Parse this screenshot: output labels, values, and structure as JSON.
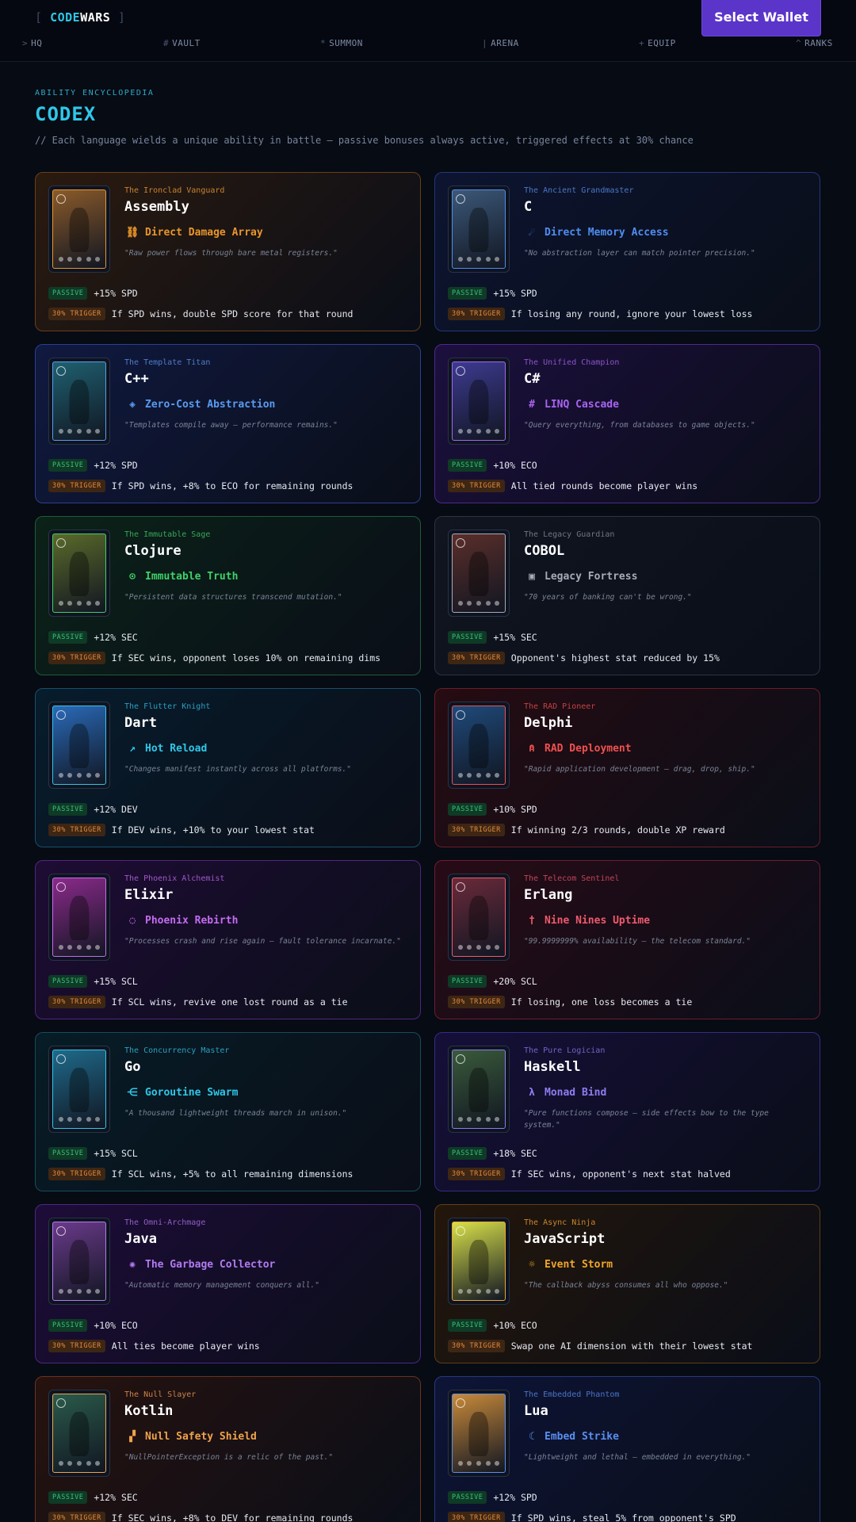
{
  "header": {
    "logo_bracket_left": "[",
    "logo_code": "CODE",
    "logo_wars": "WARS",
    "logo_bracket_right": "]",
    "wallet_button": "Select Wallet"
  },
  "nav": [
    {
      "icon": ">",
      "label": "HQ"
    },
    {
      "icon": "#",
      "label": "VAULT"
    },
    {
      "icon": "*",
      "label": "SUMMON"
    },
    {
      "icon": "|",
      "label": "ARENA"
    },
    {
      "icon": "+",
      "label": "EQUIP"
    },
    {
      "icon": "^",
      "label": "RANKS"
    }
  ],
  "intro": {
    "eyebrow": "ABILITY ENCYCLOPEDIA",
    "title": "CODEX",
    "subtitle": "// Each language wields a unique ability in battle — passive bonuses always active, triggered effects at 30% chance"
  },
  "labels": {
    "passive": "PASSIVE",
    "trigger": "30% TRIGGER"
  },
  "cards": [
    {
      "epithet": "The Ironclad Vanguard",
      "name": "Assembly",
      "ability": "Direct Damage Array",
      "icon": "⛓",
      "quote": "\"Raw power flows through bare metal registers.\"",
      "passive": "+15% SPD",
      "trigger": "If SPD wins, double SPD score for that round",
      "accent": "#e8962a",
      "epithet_color": "#c9832e",
      "bg": "#2a1a0f",
      "border": "#6b3f17",
      "art": "#8a5a2a"
    },
    {
      "epithet": "The Ancient Grandmaster",
      "name": "C",
      "ability": "Direct Memory Access",
      "icon": "☄",
      "quote": "\"No abstraction layer can match pointer precision.\"",
      "passive": "+15% SPD",
      "trigger": "If losing any round, ignore your lowest loss",
      "accent": "#4f8df0",
      "epithet_color": "#4a78c6",
      "bg": "#0c1430",
      "border": "#23377a",
      "art": "#3c5878"
    },
    {
      "epithet": "The Template Titan",
      "name": "C++",
      "ability": "Zero-Cost Abstraction",
      "icon": "◈",
      "quote": "\"Templates compile away — performance remains.\"",
      "passive": "+12% SPD",
      "trigger": "If SPD wins, +8% to ECO for remaining rounds",
      "accent": "#5a9bf0",
      "epithet_color": "#4f7cc9",
      "bg": "#101940",
      "border": "#2c3f92",
      "art": "#1f6070"
    },
    {
      "epithet": "The Unified Champion",
      "name": "C#",
      "ability": "LINQ Cascade",
      "icon": "#",
      "quote": "\"Query everything, from databases to game objects.\"",
      "passive": "+10% ECO",
      "trigger": "All tied rounds become player wins",
      "accent": "#a864f0",
      "epithet_color": "#8a55c8",
      "bg": "#1c0f3e",
      "border": "#4c2a8f",
      "art": "#3d3a90"
    },
    {
      "epithet": "The Immutable Sage",
      "name": "Clojure",
      "ability": "Immutable Truth",
      "icon": "⊙",
      "quote": "\"Persistent data structures transcend mutation.\"",
      "passive": "+12% SEC",
      "trigger": "If SEC wins, opponent loses 10% on remaining dims",
      "accent": "#3fd068",
      "epithet_color": "#36a85a",
      "bg": "#0b2218",
      "border": "#1f5c35",
      "art": "#5a6a2a"
    },
    {
      "epithet": "The Legacy Guardian",
      "name": "COBOL",
      "ability": "Legacy Fortress",
      "icon": "▣",
      "quote": "\"70 years of banking can't be wrong.\"",
      "passive": "+15% SEC",
      "trigger": "Opponent's highest stat reduced by 15%",
      "accent": "#a5acb8",
      "epithet_color": "#6e7684",
      "bg": "#101520",
      "border": "#2b3342",
      "art": "#5a2e2a"
    },
    {
      "epithet": "The Flutter Knight",
      "name": "Dart",
      "ability": "Hot Reload",
      "icon": "↗",
      "quote": "\"Changes manifest instantly across all platforms.\"",
      "passive": "+12% DEV",
      "trigger": "If DEV wins, +10% to your lowest stat",
      "accent": "#2fc7e8",
      "epithet_color": "#2a9fc0",
      "bg": "#071c2c",
      "border": "#17506b",
      "art": "#2a6ab8"
    },
    {
      "epithet": "The RAD Pioneer",
      "name": "Delphi",
      "ability": "RAD Deployment",
      "icon": "⍝",
      "quote": "\"Rapid application development — drag, drop, ship.\"",
      "passive": "+10% SPD",
      "trigger": "If winning 2/3 rounds, double XP reward",
      "accent": "#f05050",
      "epithet_color": "#c24444",
      "bg": "#260b12",
      "border": "#6b1c27",
      "art": "#1f4a7a"
    },
    {
      "epithet": "The Phoenix Alchemist",
      "name": "Elixir",
      "ability": "Phoenix Rebirth",
      "icon": "◌",
      "quote": "\"Processes crash and rise again — fault tolerance incarnate.\"",
      "passive": "+15% SCL",
      "trigger": "If SCL wins, revive one lost round as a tie",
      "accent": "#c46cf0",
      "epithet_color": "#a058c9",
      "bg": "#1e0c34",
      "border": "#52267f",
      "art": "#8a2a8a"
    },
    {
      "epithet": "The Telecom Sentinel",
      "name": "Erlang",
      "ability": "Nine Nines Uptime",
      "icon": "†",
      "quote": "\"99.9999999% availability — the telecom standard.\"",
      "passive": "+20% SCL",
      "trigger": "If losing, one loss becomes a tie",
      "accent": "#f05a6c",
      "epithet_color": "#c2455a",
      "bg": "#270b16",
      "border": "#6e1d33",
      "art": "#6a2a3a"
    },
    {
      "epithet": "The Concurrency Master",
      "name": "Go",
      "ability": "Goroutine Swarm",
      "icon": "⋲",
      "quote": "\"A thousand lightweight threads march in unison.\"",
      "passive": "+15% SCL",
      "trigger": "If SCL wins, +5% to all remaining dimensions",
      "accent": "#2fc7e8",
      "epithet_color": "#2a9fc0",
      "bg": "#071c26",
      "border": "#164c5c",
      "art": "#1f6a8a"
    },
    {
      "epithet": "The Pure Logician",
      "name": "Haskell",
      "ability": "Monad Bind",
      "icon": "λ",
      "quote": "\"Pure functions compose — side effects bow to the type system.\"",
      "passive": "+18% SEC",
      "trigger": "If SEC wins, opponent's next stat halved",
      "accent": "#8f7cf0",
      "epithet_color": "#7264c6",
      "bg": "#150f38",
      "border": "#372b85",
      "art": "#3a5a3a"
    },
    {
      "epithet": "The Omni-Archmage",
      "name": "Java",
      "ability": "The Garbage Collector",
      "icon": "✺",
      "quote": "\"Automatic memory management conquers all.\"",
      "passive": "+10% ECO",
      "trigger": "All ties become player wins",
      "accent": "#b27af0",
      "epithet_color": "#9060c6",
      "bg": "#1d0c38",
      "border": "#4d2784",
      "art": "#6a3a8a"
    },
    {
      "epithet": "The Async Ninja",
      "name": "JavaScript",
      "ability": "Event Storm",
      "icon": "☼",
      "quote": "\"The callback abyss consumes all who oppose.\"",
      "passive": "+10% ECO",
      "trigger": "Swap one AI dimension with their lowest stat",
      "accent": "#f0a62a",
      "epithet_color": "#c9872a",
      "bg": "#23160b",
      "border": "#5f3e17",
      "art": "#d8e04a"
    },
    {
      "epithet": "The Null Slayer",
      "name": "Kotlin",
      "ability": "Null Safety Shield",
      "icon": "▞",
      "quote": "\"NullPointerException is a relic of the past.\"",
      "passive": "+12% SEC",
      "trigger": "If SEC wins, +8% to DEV for remaining rounds",
      "accent": "#f0a24a",
      "epithet_color": "#c9834a",
      "bg": "#26120f",
      "border": "#6b3220",
      "art": "#2a5a4a"
    },
    {
      "epithet": "The Embedded Phantom",
      "name": "Lua",
      "ability": "Embed Strike",
      "icon": "☾",
      "quote": "\"Lightweight and lethal — embedded in everything.\"",
      "passive": "+12% SPD",
      "trigger": "If SPD wins, steal 5% from opponent's SPD",
      "accent": "#5a8ef0",
      "epithet_color": "#4a74c6",
      "bg": "#0d1436",
      "border": "#27397f",
      "art": "#c88a3a"
    }
  ]
}
